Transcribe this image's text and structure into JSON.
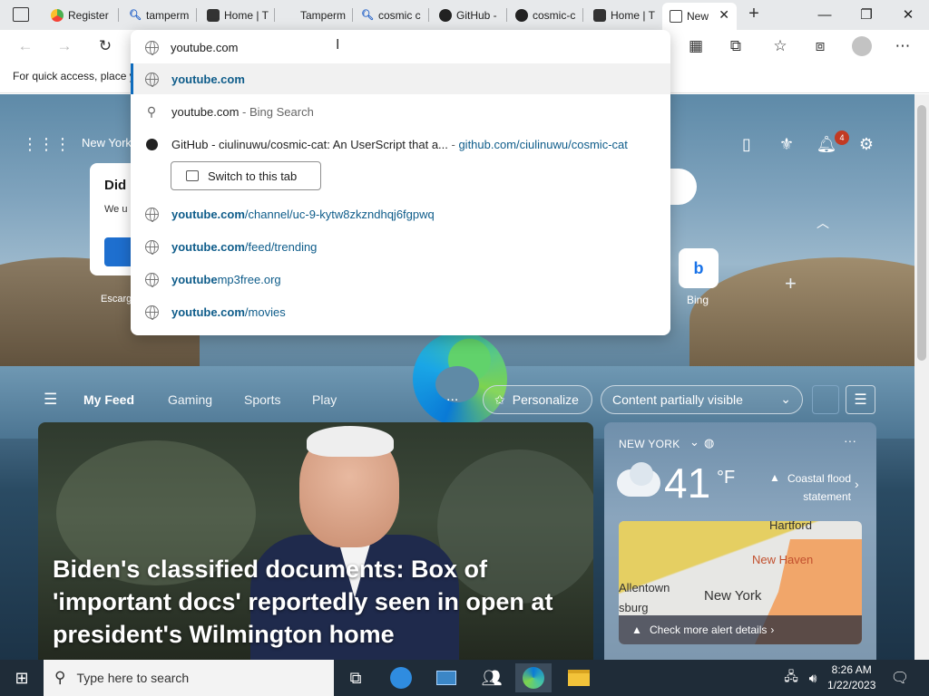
{
  "tabs": [
    {
      "label": "Register",
      "icon": "colorful-circle-icon"
    },
    {
      "label": "tamperm",
      "icon": "search-icon"
    },
    {
      "label": "Home | T",
      "icon": "tampermonkey-icon"
    },
    {
      "label": "Tamperm",
      "icon": "microsoft-store-icon"
    },
    {
      "label": "cosmic c",
      "icon": "search-icon"
    },
    {
      "label": "GitHub -",
      "icon": "github-icon"
    },
    {
      "label": "cosmic-c",
      "icon": "github-icon"
    },
    {
      "label": "Home | T",
      "icon": "tampermonkey-icon"
    },
    {
      "label": "New",
      "icon": "new-tab-icon",
      "active": true
    }
  ],
  "favbar": {
    "hint": "For quick access, place y"
  },
  "omnibox": {
    "value": "youtube.com",
    "suggestions": [
      {
        "bold": "youtube.com",
        "rest": ""
      },
      {
        "text": "youtube.com",
        "suffix": " - Bing Search"
      },
      {
        "text": "GitHub - ciulinuwu/cosmic-cat: An UserScript that a...",
        "sep": " - ",
        "url": "github.com/ciulinuwu/cosmic-cat"
      },
      {
        "bold": "youtube.com",
        "rest": "/channel/uc-9-kytw8zkzndhqj6fgpwq"
      },
      {
        "bold": "youtube.com",
        "rest": "/feed/trending"
      },
      {
        "bold": "youtube",
        "rest": "mp3free.org"
      },
      {
        "bold": "youtube.com",
        "rest": "/movies"
      }
    ],
    "switch_tab": "Switch to this tab"
  },
  "ntp": {
    "weather_city": "New York",
    "notif_count": "4",
    "did_title": "Did",
    "did_body": "We u news,",
    "escarg": "Escarg",
    "bing_label": "Bing",
    "feed_tabs": [
      "My Feed",
      "Gaming",
      "Sports",
      "Play"
    ],
    "feed_more": "...",
    "personalize": "Personalize",
    "content_visibility": "Content partially visible",
    "hero_headline": "Biden's classified documents: Box of 'important docs' reportedly seen in open at president's Wilmington home",
    "weather": {
      "city": "NEW YORK",
      "more": "···",
      "temp": "41",
      "unit": "°F",
      "alert": "Coastal flood statement",
      "map_labels": [
        "Hartford",
        "New Haven",
        "Allentown",
        "New York",
        "sburg"
      ],
      "map_footer": "Check more alert details"
    }
  },
  "taskbar": {
    "search_placeholder": "Type here to search",
    "time": "8:26 AM",
    "date": "1/22/2023"
  }
}
